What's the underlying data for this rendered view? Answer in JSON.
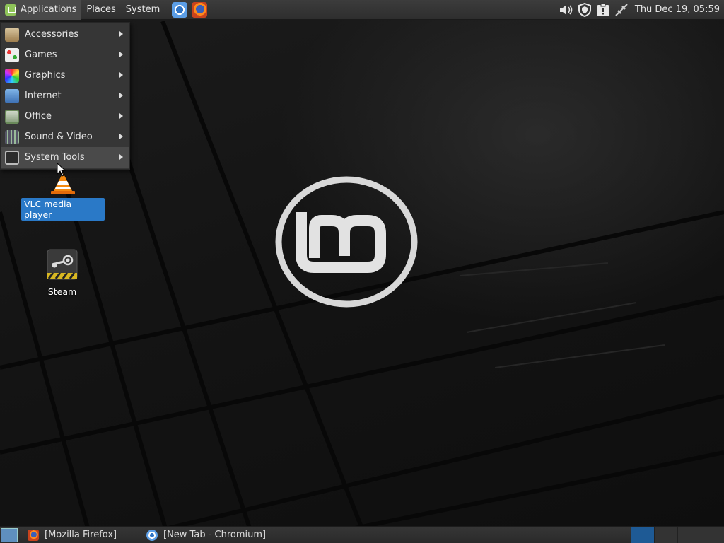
{
  "top_panel": {
    "menus": [
      "Applications",
      "Places",
      "System"
    ],
    "launchers": [
      "chromium-icon",
      "firefox-icon"
    ],
    "clock": "Thu Dec 19, 05:59",
    "tray_icons": [
      "volume-icon",
      "shield-icon",
      "clipboard-alert-icon",
      "network-disconnected-icon"
    ]
  },
  "app_menu": {
    "items": [
      {
        "label": "Accessories",
        "icon": "accessories-icon"
      },
      {
        "label": "Games",
        "icon": "games-icon"
      },
      {
        "label": "Graphics",
        "icon": "graphics-icon"
      },
      {
        "label": "Internet",
        "icon": "internet-icon"
      },
      {
        "label": "Office",
        "icon": "office-icon"
      },
      {
        "label": "Sound & Video",
        "icon": "sound-video-icon"
      },
      {
        "label": "System Tools",
        "icon": "system-tools-icon"
      }
    ],
    "hovered": "System Tools"
  },
  "desktop": {
    "icons": [
      {
        "label": "VLC media player",
        "icon": "vlc-icon",
        "selected": true
      },
      {
        "label": "Steam",
        "icon": "steam-icon",
        "selected": false
      }
    ]
  },
  "taskbar": {
    "tasks": [
      {
        "label": "[Mozilla Firefox]",
        "icon": "firefox-icon"
      },
      {
        "label": "[New Tab - Chromium]",
        "icon": "chromium-icon"
      }
    ],
    "workspace_count": 4,
    "active_workspace": 1
  },
  "colors": {
    "panel": "#2e2e2e",
    "menu_bg": "#363636",
    "selection": "#2a79c7",
    "mint_green": "#8fc45a"
  }
}
